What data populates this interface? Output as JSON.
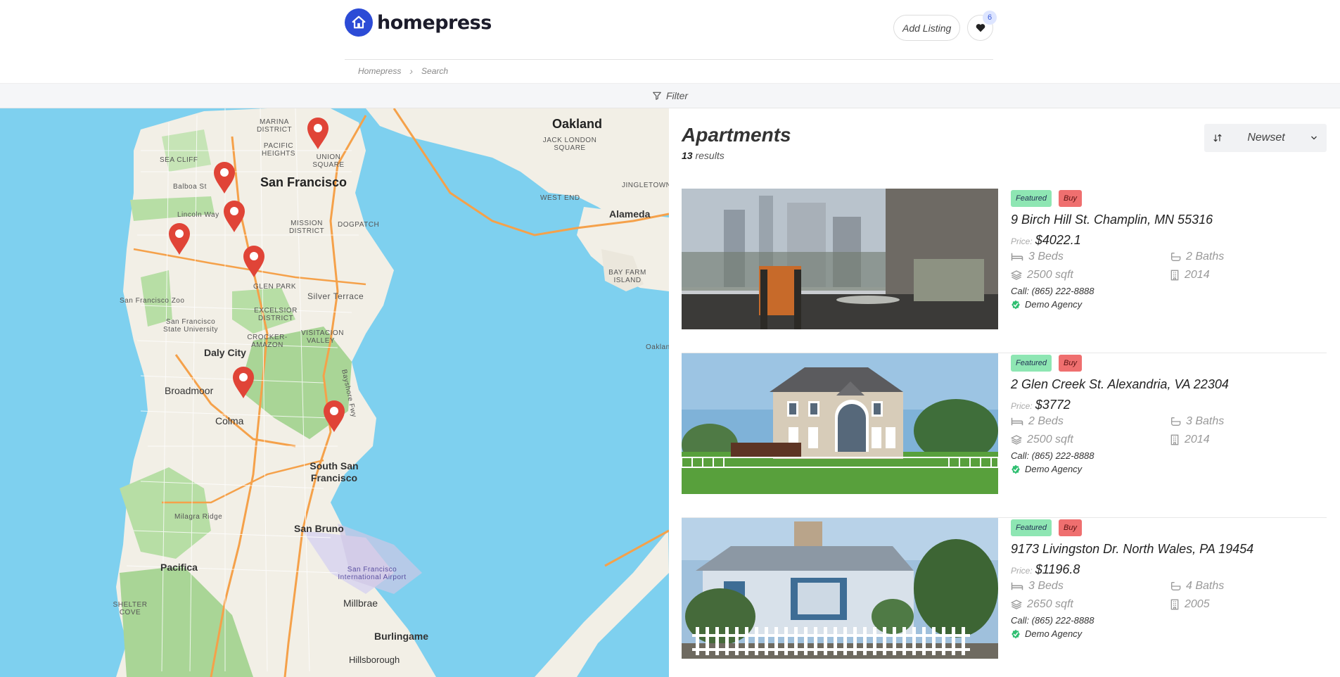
{
  "header": {
    "brand": "homepress",
    "add_listing": "Add Listing",
    "favorites_count": "6",
    "breadcrumb": [
      "Homepress",
      "Search"
    ]
  },
  "filter": {
    "label": "Filter"
  },
  "map": {
    "labels": {
      "oakland": "Oakland",
      "san_francisco": "San Francisco",
      "alameda": "Alameda",
      "daly_city": "Daly City",
      "broadmoor": "Broadmoor",
      "colma": "Colma",
      "south_sf": "South San Francisco",
      "san_bruno": "San Bruno",
      "pacifica": "Pacifica",
      "millbrae": "Millbrae",
      "burlingame": "Burlingame",
      "hillsborough": "Hillsborough",
      "silver_terrace": "Silver Terrace",
      "marina": "MARINA DISTRICT",
      "pacific_heights": "PACIFIC HEIGHTS",
      "union_square": "UNION SQUARE",
      "sea_cliff": "SEA CLIFF",
      "balboa": "Balboa St",
      "lincoln": "Lincoln Way",
      "mission": "MISSION DISTRICT",
      "dogpatch": "DOGPATCH",
      "glen_park": "GLEN PARK",
      "excelsior": "EXCELSIOR DISTRICT",
      "crocker": "CROCKER-AMAZON",
      "visitacion": "VISITACION VALLEY",
      "sf_zoo": "San Francisco Zoo",
      "sfsu": "San Francisco State University",
      "jack_london": "JACK LONDON SQUARE",
      "west_end": "WEST END",
      "jingletown": "JINGLETOWN",
      "bay_farm": "BAY FARM ISLAND",
      "milagra": "Milagra Ridge",
      "sfo": "San Francisco International Airport",
      "shelter_cove": "SHELTER COVE",
      "bayshore": "Bayshore Fwy",
      "oakland_edge": "Oaklan"
    }
  },
  "panel": {
    "title": "Apartments",
    "results_count": "13",
    "results_label": "results",
    "sort": "Newset"
  },
  "listings": [
    {
      "badge_featured": "Featured",
      "badge_type": "Buy",
      "address": "9 Birch Hill St. Champlin, MN 55316",
      "price_label": "Price:",
      "price": "$4022.1",
      "beds": "3 Beds",
      "baths": "2 Baths",
      "area": "2500 sqft",
      "year": "2014",
      "call": "Call: (865) 222-8888",
      "agency": "Demo Agency"
    },
    {
      "badge_featured": "Featured",
      "badge_type": "Buy",
      "address": "2 Glen Creek St. Alexandria, VA 22304",
      "price_label": "Price:",
      "price": "$3772",
      "beds": "2 Beds",
      "baths": "3 Baths",
      "area": "2500 sqft",
      "year": "2014",
      "call": "Call: (865) 222-8888",
      "agency": "Demo Agency"
    },
    {
      "badge_featured": "Featured",
      "badge_type": "Buy",
      "address": "9173 Livingston Dr. North Wales, PA 19454",
      "price_label": "Price:",
      "price": "$1196.8",
      "beds": "3 Beds",
      "baths": "4 Baths",
      "area": "2650 sqft",
      "year": "2005",
      "call": "Call: (865) 222-8888",
      "agency": "Demo Agency"
    }
  ],
  "colors": {
    "brand": "#2c4bd6",
    "water": "#7ed0ef",
    "land": "#f2efe6",
    "park": "#b7dea5",
    "road": "#f5a14a",
    "pin": "#e04437",
    "featured": "#8ee6b3",
    "buy": "#ef6f6f"
  }
}
